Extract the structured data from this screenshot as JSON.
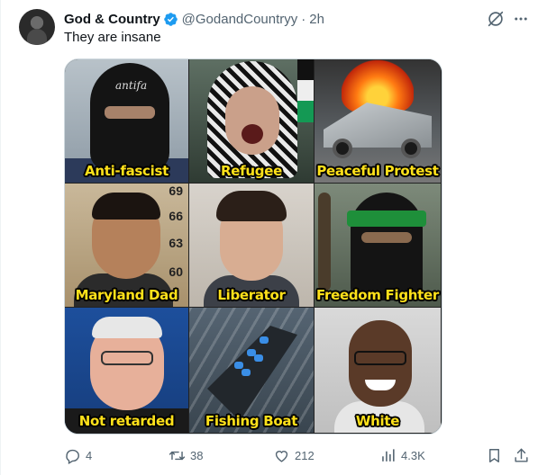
{
  "tweet": {
    "display_name": "God & Country",
    "handle": "@GodandCountryy",
    "dot": "·",
    "time": "2h",
    "text": "They are insane"
  },
  "media": {
    "panels": [
      {
        "caption": "Anti-fascist"
      },
      {
        "caption": "Refugee"
      },
      {
        "caption": "Peaceful Protest"
      },
      {
        "caption": "Maryland Dad"
      },
      {
        "caption": "Liberator"
      },
      {
        "caption": "Freedom Fighter"
      },
      {
        "caption": "Not retarded"
      },
      {
        "caption": "Fishing Boat"
      },
      {
        "caption": "White"
      }
    ],
    "mugshot_ruler": [
      "69",
      "66",
      "63",
      "60"
    ]
  },
  "actions": {
    "replies": "4",
    "reposts": "38",
    "likes": "212",
    "views": "4.3K"
  },
  "colors": {
    "verified": "#1d9bf0",
    "caption": "#ffe11a",
    "icon": "#536471"
  },
  "icons": [
    "verified-badge-icon",
    "grok-icon",
    "more-icon",
    "reply-icon",
    "repost-icon",
    "like-icon",
    "views-icon",
    "bookmark-icon",
    "share-icon"
  ]
}
